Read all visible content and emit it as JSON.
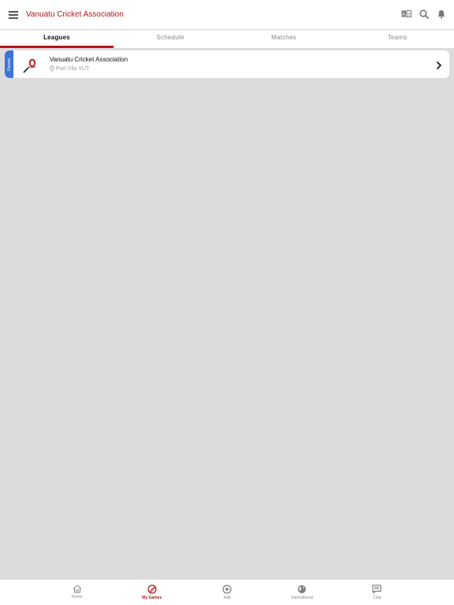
{
  "header": {
    "title": "Vanuatu Cricket Association"
  },
  "tabs": [
    {
      "label": "Leagues",
      "active": true
    },
    {
      "label": "Schedule",
      "active": false
    },
    {
      "label": "Matches",
      "active": false
    },
    {
      "label": "Teams",
      "active": false
    }
  ],
  "leagues": [
    {
      "tag": "Recent",
      "name": "Vanuatu Cricket Association",
      "location": "Port Vila VUT"
    }
  ],
  "bottom_nav": [
    {
      "label": "Home",
      "icon": "home-icon",
      "active": false
    },
    {
      "label": "My Games",
      "icon": "cricket-ball-icon",
      "active": true
    },
    {
      "label": "Add",
      "icon": "plus-circle-icon",
      "active": false
    },
    {
      "label": "International",
      "icon": "globe-icon",
      "active": false
    },
    {
      "label": "Chat",
      "icon": "chat-icon",
      "active": false
    }
  ],
  "colors": {
    "accent": "#b3141c",
    "recent_tag": "#3b74d9",
    "background": "#dcdcdc"
  }
}
